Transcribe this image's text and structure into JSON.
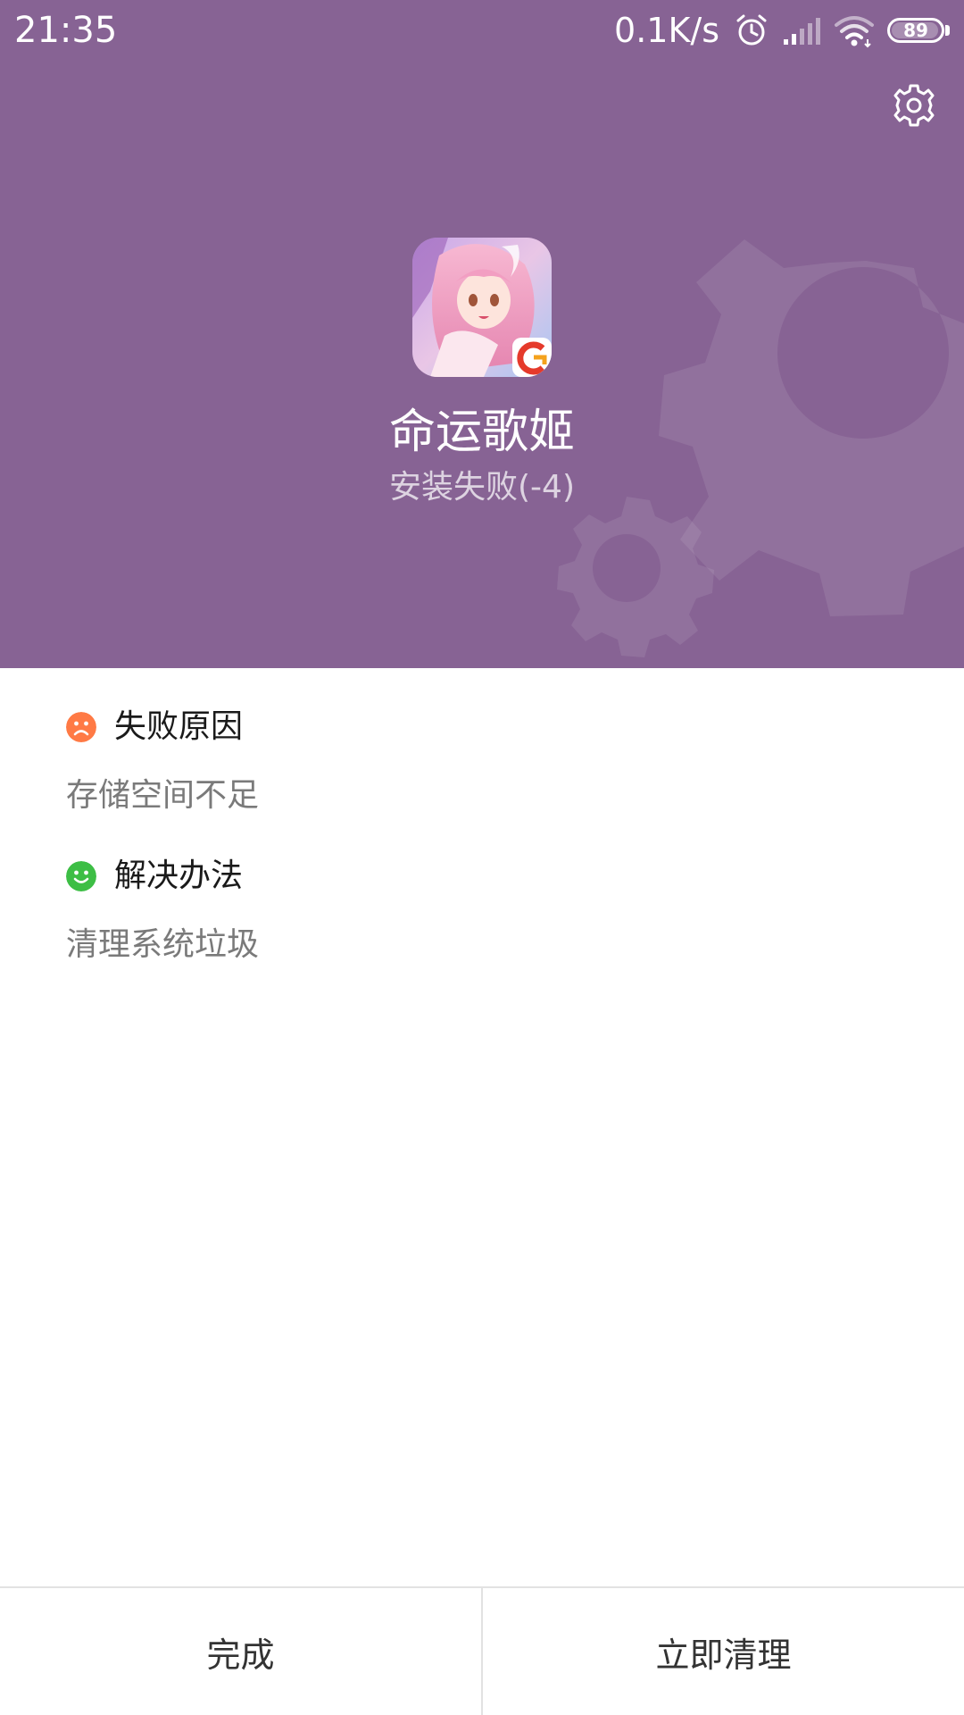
{
  "status_bar": {
    "time": "21:35",
    "net_speed": "0.1K/s",
    "battery": "89",
    "icons": [
      "alarm-icon",
      "signal-icon",
      "wifi-icon",
      "battery-icon"
    ]
  },
  "header": {
    "settings_icon": "gear-icon",
    "app_name": "命运歌姬",
    "install_status": "安装失败(-4)"
  },
  "failure": {
    "title": "失败原因",
    "icon": "sad-face-icon",
    "reason": "存储空间不足"
  },
  "solution": {
    "title": "解决办法",
    "icon": "happy-face-icon",
    "text": "清理系统垃圾"
  },
  "buttons": {
    "done": "完成",
    "clean_now": "立即清理"
  },
  "colors": {
    "header_bg": "#876394",
    "failure_icon": "#FF7A45",
    "solution_icon": "#3DBE45"
  }
}
